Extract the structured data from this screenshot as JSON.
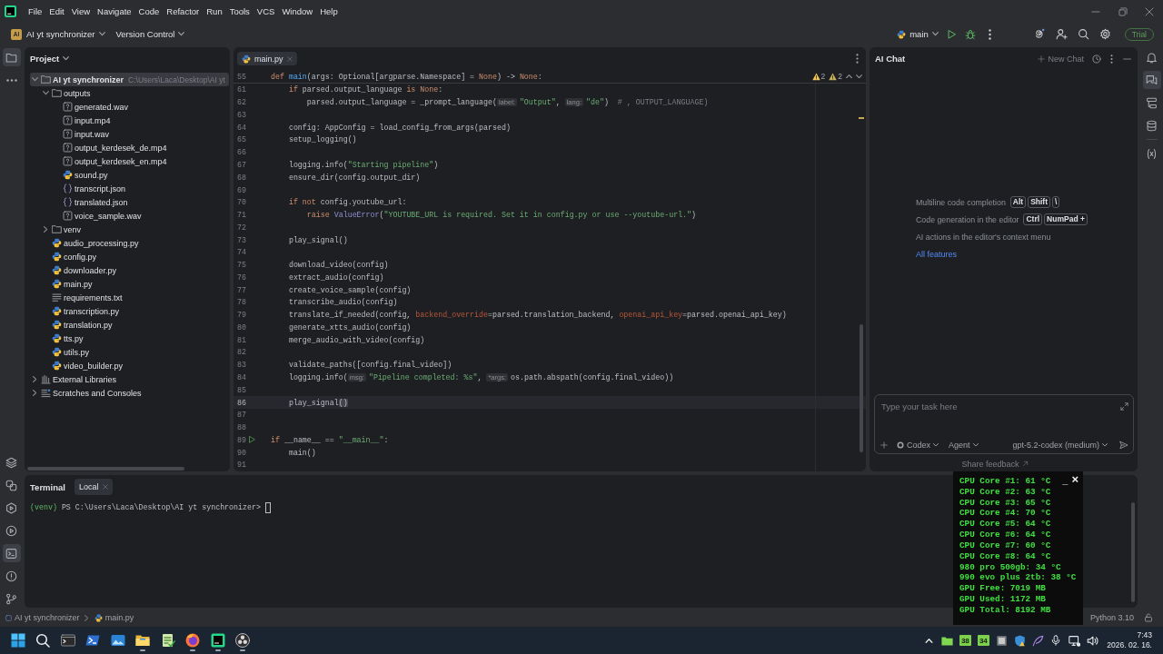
{
  "menu_bar": [
    "File",
    "Edit",
    "View",
    "Navigate",
    "Code",
    "Refactor",
    "Run",
    "Tools",
    "VCS",
    "Window",
    "Help"
  ],
  "toolbar": {
    "project_badge": "AI",
    "project": "AI yt synchronizer",
    "vcs": "Version Control",
    "branch": "main",
    "trial": "Trial"
  },
  "left_toolbar": {
    "top": [
      {
        "kind": "project",
        "selected": true
      },
      {
        "kind": "more",
        "selected": false
      }
    ],
    "bottom": [
      {
        "kind": "packages",
        "selected": false
      },
      {
        "kind": "console",
        "selected": false
      },
      {
        "kind": "services",
        "selected": false
      },
      {
        "kind": "run",
        "selected": false
      },
      {
        "kind": "terminal",
        "selected": true
      },
      {
        "kind": "problems",
        "selected": false
      },
      {
        "kind": "git",
        "selected": false
      }
    ]
  },
  "project_panel": {
    "title": "Project",
    "tree": [
      {
        "label": "AI yt synchronizer",
        "location": "C:\\Users\\Laca\\Desktop\\AI yt",
        "kind": "folder",
        "expanded": true,
        "selected": true,
        "children": [
          {
            "label": "outputs",
            "kind": "folder",
            "expanded": true,
            "selected": false,
            "children": [
              {
                "label": "generated.wav",
                "kind": "unknown",
                "selected": false
              },
              {
                "label": "input.mp4",
                "kind": "unknown",
                "selected": false
              },
              {
                "label": "input.wav",
                "kind": "unknown",
                "selected": false
              },
              {
                "label": "output_kerdesek_de.mp4",
                "kind": "unknown",
                "selected": false
              },
              {
                "label": "output_kerdesek_en.mp4",
                "kind": "unknown",
                "selected": false
              },
              {
                "label": "sound.py",
                "kind": "python",
                "selected": false
              },
              {
                "label": "transcript.json",
                "kind": "json",
                "selected": false
              },
              {
                "label": "translated.json",
                "kind": "json",
                "selected": false
              },
              {
                "label": "voice_sample.wav",
                "kind": "unknown",
                "selected": false
              }
            ]
          },
          {
            "label": "venv",
            "kind": "folder",
            "expanded": false,
            "selected": false
          },
          {
            "label": "audio_processing.py",
            "kind": "python",
            "selected": false
          },
          {
            "label": "config.py",
            "kind": "python",
            "selected": false
          },
          {
            "label": "downloader.py",
            "kind": "python",
            "selected": false
          },
          {
            "label": "main.py",
            "kind": "python",
            "selected": false
          },
          {
            "label": "requirements.txt",
            "kind": "text",
            "selected": false
          },
          {
            "label": "transcription.py",
            "kind": "python",
            "selected": false
          },
          {
            "label": "translation.py",
            "kind": "python",
            "selected": false
          },
          {
            "label": "tts.py",
            "kind": "python",
            "selected": false
          },
          {
            "label": "utils.py",
            "kind": "python",
            "selected": false
          },
          {
            "label": "video_builder.py",
            "kind": "python",
            "selected": false
          }
        ]
      },
      {
        "label": "External Libraries",
        "kind": "library",
        "expanded": false,
        "selected": false
      },
      {
        "label": "Scratches and Consoles",
        "kind": "scratches",
        "expanded": false,
        "selected": false
      }
    ]
  },
  "editor": {
    "tabs": [
      {
        "label": "main.py",
        "selected": true
      }
    ],
    "inspections": [
      {
        "kind": "warning",
        "count": "2"
      },
      {
        "kind": "weak",
        "count": "2"
      }
    ],
    "sticky_line": {
      "number": "55",
      "tokens": [
        {
          "kind": "keyword",
          "text": "def"
        },
        {
          "kind": "def",
          "text": " main"
        },
        {
          "kind": "plain",
          "text": "(args: Optional[argparse.Namespace] = "
        },
        {
          "kind": "keyword",
          "text": "None"
        },
        {
          "kind": "plain",
          "text": ") -> "
        },
        {
          "kind": "keyword",
          "text": "None"
        },
        {
          "kind": "plain",
          "text": ":"
        }
      ]
    },
    "lines": [
      {
        "number": "61",
        "current": false,
        "run": false,
        "tokens": [
          {
            "kind": "keyword",
            "text": "    if"
          },
          {
            "kind": "plain",
            "text": " parsed.output_language "
          },
          {
            "kind": "keyword",
            "text": "is None"
          },
          {
            "kind": "plain",
            "text": ":"
          }
        ]
      },
      {
        "number": "62",
        "current": false,
        "run": false,
        "tokens": [
          {
            "kind": "plain",
            "text": "        parsed.output_language = _prompt_language("
          },
          {
            "kind": "hint",
            "text": "label:"
          },
          {
            "kind": "string",
            "text": "\"Output\""
          },
          {
            "kind": "plain",
            "text": ", "
          },
          {
            "kind": "hint",
            "text": "lang:"
          },
          {
            "kind": "string",
            "text": "\"de\""
          },
          {
            "kind": "plain",
            "text": ")  "
          },
          {
            "kind": "comment",
            "text": "# , OUTPUT_LANGUAGE)"
          }
        ]
      },
      {
        "number": "63",
        "current": false,
        "run": false
      },
      {
        "number": "64",
        "current": false,
        "run": false,
        "tokens": [
          {
            "kind": "plain",
            "text": "    config: AppConfig = load_config_from_args(parsed)"
          }
        ]
      },
      {
        "number": "65",
        "current": false,
        "run": false,
        "tokens": [
          {
            "kind": "plain",
            "text": "    setup_logging()"
          }
        ]
      },
      {
        "number": "66",
        "current": false,
        "run": false
      },
      {
        "number": "67",
        "current": false,
        "run": false,
        "tokens": [
          {
            "kind": "plain",
            "text": "    logging.info("
          },
          {
            "kind": "string",
            "text": "\"Starting pipeline\""
          },
          {
            "kind": "plain",
            "text": ")"
          }
        ]
      },
      {
        "number": "68",
        "current": false,
        "run": false,
        "tokens": [
          {
            "kind": "plain",
            "text": "    ensure_dir(config.output_dir)"
          }
        ]
      },
      {
        "number": "69",
        "current": false,
        "run": false
      },
      {
        "number": "70",
        "current": false,
        "run": false,
        "tokens": [
          {
            "kind": "keyword",
            "text": "    if not"
          },
          {
            "kind": "plain",
            "text": " config.youtube_url:"
          }
        ]
      },
      {
        "number": "71",
        "current": false,
        "run": false,
        "tokens": [
          {
            "kind": "keyword",
            "text": "        raise"
          },
          {
            "kind": "builtin",
            "text": " ValueError"
          },
          {
            "kind": "plain",
            "text": "("
          },
          {
            "kind": "string",
            "text": "\"YOUTUBE_URL is required. Set it in config.py or use --youtube-url.\""
          },
          {
            "kind": "plain",
            "text": ")"
          }
        ]
      },
      {
        "number": "72",
        "current": false,
        "run": false
      },
      {
        "number": "73",
        "current": false,
        "run": false,
        "tokens": [
          {
            "kind": "plain",
            "text": "    play_signal()"
          }
        ]
      },
      {
        "number": "74",
        "current": false,
        "run": false
      },
      {
        "number": "75",
        "current": false,
        "run": false,
        "tokens": [
          {
            "kind": "plain",
            "text": "    download_video(config)"
          }
        ]
      },
      {
        "number": "76",
        "current": false,
        "run": false,
        "tokens": [
          {
            "kind": "plain",
            "text": "    extract_audio(config)"
          }
        ]
      },
      {
        "number": "77",
        "current": false,
        "run": false,
        "tokens": [
          {
            "kind": "plain",
            "text": "    create_voice_sample(config)"
          }
        ]
      },
      {
        "number": "78",
        "current": false,
        "run": false,
        "tokens": [
          {
            "kind": "plain",
            "text": "    transcribe_audio(config)"
          }
        ]
      },
      {
        "number": "79",
        "current": false,
        "run": false,
        "tokens": [
          {
            "kind": "plain",
            "text": "    translate_if_needed(config, "
          },
          {
            "kind": "param",
            "text": "backend_override"
          },
          {
            "kind": "plain",
            "text": "=parsed.translation_backend, "
          },
          {
            "kind": "param",
            "text": "openai_api_key"
          },
          {
            "kind": "plain",
            "text": "=parsed.openai_api_key)"
          }
        ]
      },
      {
        "number": "80",
        "current": false,
        "run": false,
        "tokens": [
          {
            "kind": "plain",
            "text": "    generate_xtts_audio(config)"
          }
        ]
      },
      {
        "number": "81",
        "current": false,
        "run": false,
        "tokens": [
          {
            "kind": "plain",
            "text": "    merge_audio_with_video(config)"
          }
        ]
      },
      {
        "number": "82",
        "current": false,
        "run": false
      },
      {
        "number": "83",
        "current": false,
        "run": false,
        "tokens": [
          {
            "kind": "plain",
            "text": "    validate_paths([config.final_video])"
          }
        ]
      },
      {
        "number": "84",
        "current": false,
        "run": false,
        "tokens": [
          {
            "kind": "plain",
            "text": "    logging.info("
          },
          {
            "kind": "hint",
            "text": "msg:"
          },
          {
            "kind": "string",
            "text": "\"Pipeline completed: %s\""
          },
          {
            "kind": "plain",
            "text": ", "
          },
          {
            "kind": "hint",
            "text": "*args:"
          },
          {
            "kind": "plain",
            "text": "os.path.abspath(config.final_video))"
          }
        ]
      },
      {
        "number": "85",
        "current": false,
        "run": false
      },
      {
        "number": "86",
        "current": true,
        "run": false,
        "tokens": [
          {
            "kind": "plain",
            "text": "    play_signal"
          },
          {
            "kind": "brace",
            "text": "()"
          }
        ]
      },
      {
        "number": "87",
        "current": false,
        "run": false
      },
      {
        "number": "88",
        "current": false,
        "run": false
      },
      {
        "number": "89",
        "current": false,
        "run": true,
        "tokens": [
          {
            "kind": "keyword",
            "text": "if"
          },
          {
            "kind": "plain",
            "text": " __name__ == "
          },
          {
            "kind": "string",
            "text": "\"__main__\""
          },
          {
            "kind": "plain",
            "text": ":"
          }
        ]
      },
      {
        "number": "90",
        "current": false,
        "run": false,
        "tokens": [
          {
            "kind": "plain",
            "text": "    main()"
          }
        ]
      },
      {
        "number": "91",
        "current": false,
        "run": false
      }
    ]
  },
  "ai_chat": {
    "title": "AI Chat",
    "new_chat": "New Chat",
    "tips": [
      {
        "text": "Multiline code completion",
        "keys": [
          "Alt",
          "Shift",
          "\\"
        ]
      },
      {
        "text": "Code generation in the editor",
        "keys": [
          "Ctrl",
          "NumPad +"
        ]
      },
      {
        "text": "AI actions in the editor's context menu"
      }
    ],
    "link": "All features",
    "input": {
      "placeholder": "Type your task here"
    },
    "agent": "Codex",
    "mode": "Agent",
    "model": "gpt-5.2-codex (medium)",
    "feedback": "Share feedback"
  },
  "right_toolbar": [
    {
      "kind": "notifications",
      "selected": false
    },
    {
      "kind": "chat",
      "selected": true
    },
    {
      "kind": "structure",
      "selected": false
    },
    {
      "kind": "database",
      "selected": false
    },
    {
      "kind": "variables",
      "selected": false
    }
  ],
  "terminal": {
    "title": "Terminal",
    "tabs": [
      {
        "label": "Local",
        "selected": true
      }
    ],
    "env": "(venv)",
    "prompt": "PS C:\\Users\\Laca\\Desktop\\AI yt synchronizer>"
  },
  "status_bar": {
    "breadcrumbs": [
      {
        "kind": "module",
        "label": "AI yt synchronizer"
      },
      {
        "kind": "python",
        "label": "main.py"
      }
    ],
    "interpreter": "Python 3.10"
  },
  "sensor_overlay": {
    "minimize": "_",
    "close": "×",
    "readings": [
      "CPU Core #1: 61 °C",
      "CPU Core #2: 63 °C",
      "CPU Core #3: 65 °C",
      "CPU Core #4: 70 °C",
      "CPU Core #5: 64 °C",
      "CPU Core #6: 64 °C",
      "CPU Core #7: 60 °C",
      "CPU Core #8: 64 °C",
      "980 pro 500gb: 34 °C",
      "990 evo plus 2tb: 38 °C",
      "GPU Free: 7019 MB",
      "GPU Used: 1172 MB",
      "GPU Total: 8192 MB"
    ]
  },
  "taskbar": {
    "apps": [
      {
        "kind": "start",
        "running": false
      },
      {
        "kind": "search",
        "running": false
      },
      {
        "kind": "terminal",
        "running": false
      },
      {
        "kind": "powershell",
        "running": false
      },
      {
        "kind": "photos",
        "running": false
      },
      {
        "kind": "explorer",
        "running": true
      },
      {
        "kind": "notepad",
        "running": false
      },
      {
        "kind": "browser",
        "running": true
      },
      {
        "kind": "ide",
        "running": true
      },
      {
        "kind": "recorder",
        "running": true
      }
    ],
    "tray_badges": [
      "38",
      "34"
    ],
    "time": "7:43",
    "date": "2026. 02. 16."
  }
}
